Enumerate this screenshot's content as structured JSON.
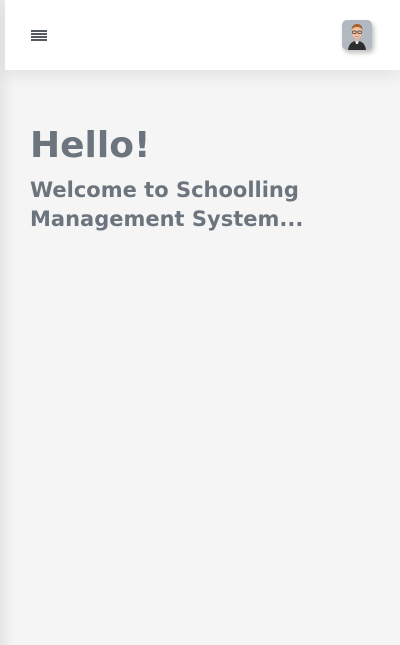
{
  "header": {
    "menu_icon": "hamburger-menu-icon",
    "avatar_icon": "user-avatar"
  },
  "main": {
    "greeting": "Hello!",
    "welcome_line1": "Welcome to Schoolling",
    "welcome_line2": "Management System..."
  },
  "colors": {
    "background": "#f5f5f5",
    "header_bg": "#ffffff",
    "text": "#6c757d"
  }
}
